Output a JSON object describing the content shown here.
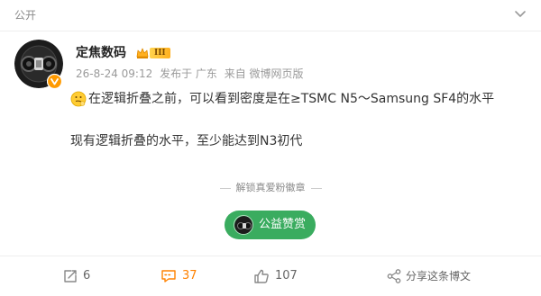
{
  "header": {
    "visibility": "公开"
  },
  "post": {
    "author": {
      "name": "定焦数码",
      "level": "III"
    },
    "meta": {
      "time": "26-8-24 09:12",
      "location": "发布于 广东",
      "source": "来自 微博网页版"
    },
    "paragraph_1": "在逻辑折叠之前，可以看到密度是在≥TSMC N5～Samsung SF4的水平",
    "paragraph_2": "现有逻辑折叠的水平，至少能达到N3初代",
    "unlock_label": "解锁真爱粉徽章",
    "reward_label": "公益赞赏"
  },
  "actions": {
    "repost_count": "6",
    "comment_count": "37",
    "like_count": "107",
    "share_label": "分享这条博文"
  },
  "colors": {
    "accent_orange": "#ff8200",
    "reward_green": "#3aac5f",
    "verified_orange": "#ff9a00",
    "level_gold": "#ffb01f"
  },
  "icons": {
    "chevron": "chevron-down-icon",
    "verified": "verified-badge-icon",
    "crown": "crown-icon",
    "emoji": "thinking-face-emoji",
    "repost": "repost-icon",
    "comment": "comment-icon",
    "like": "thumbs-up-icon",
    "share": "share-icon"
  }
}
